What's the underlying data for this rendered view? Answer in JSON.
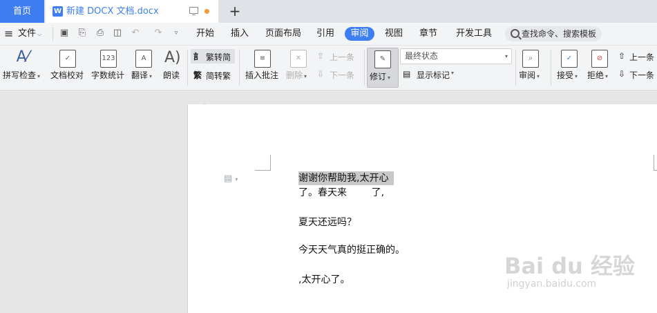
{
  "tabs": {
    "home": "首页",
    "doc_icon": "W",
    "doc_title": "新建 DOCX 文档.docx",
    "new_tab": "+"
  },
  "menu": {
    "hamburger": "≡",
    "file": "文件",
    "items": [
      "开始",
      "插入",
      "页面布局",
      "引用",
      "审阅",
      "视图",
      "章节",
      "开发工具"
    ],
    "active": "审阅",
    "search_placeholder": "查找命令、搜索模板"
  },
  "ribbon": {
    "spell_check": "拼写检查",
    "doc_proof": "文档校对",
    "word_count": "字数统计",
    "word_count_icon": "123",
    "translate": "翻译",
    "read_aloud": "朗读",
    "trad_to_simp": "繁转简",
    "simp_to_trad": "简转繁",
    "insert_comment": "插入批注",
    "delete": "删除",
    "prev_item": "上一条",
    "next_item": "下一条",
    "track_changes": "修订",
    "final_status": "最终状态",
    "show_markup": "显示标记",
    "review": "审阅",
    "accept": "接受",
    "reject": "拒绝",
    "prev_item_2": "上一条",
    "next_item_2": "下一条"
  },
  "document": {
    "lines": [
      "谢谢你帮助我,太开心",
      "了。春天来        了,",
      "夏天还远吗？",
      "今天天气真的挺正确的。",
      ",太开心了。"
    ]
  },
  "watermark": {
    "brand": "Bai du 经验",
    "url": "jingyan.baidu.com"
  },
  "colors": {
    "accent": "#3d7ef3",
    "arrow": "#e8231c",
    "selection": "#c8c8c8"
  }
}
